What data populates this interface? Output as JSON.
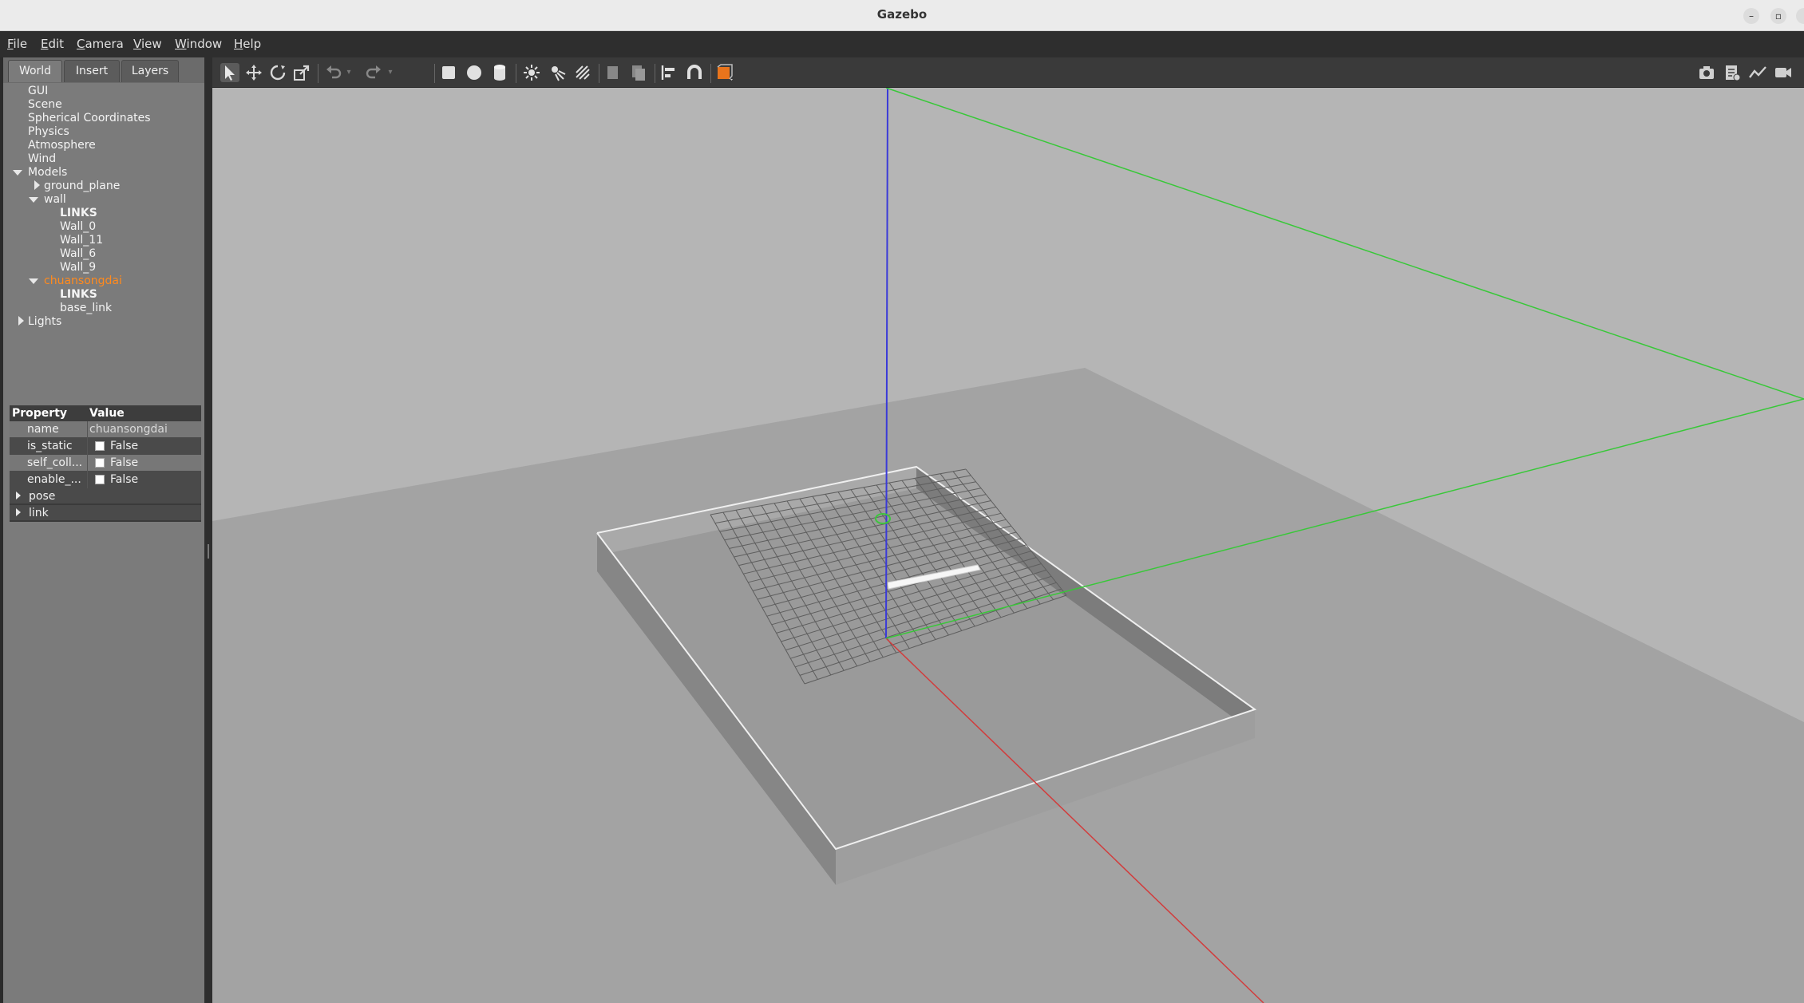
{
  "window": {
    "title": "Gazebo",
    "controls": [
      "minimize",
      "maximize",
      "close"
    ]
  },
  "menubar": {
    "items": [
      {
        "underline": "F",
        "rest": "ile"
      },
      {
        "underline": "E",
        "rest": "dit"
      },
      {
        "underline": "C",
        "rest": "amera"
      },
      {
        "underline": "V",
        "rest": "iew"
      },
      {
        "underline": "W",
        "rest": "indow"
      },
      {
        "underline": "H",
        "rest": "elp"
      }
    ]
  },
  "tabs": [
    "World",
    "Insert",
    "Layers"
  ],
  "active_tab": "World",
  "tree": {
    "gui": "GUI",
    "scene": "Scene",
    "spherical": "Spherical Coordinates",
    "physics": "Physics",
    "atmosphere": "Atmosphere",
    "wind": "Wind",
    "models": "Models",
    "ground_plane": "ground_plane",
    "wall": "wall",
    "wall_links": "LINKS",
    "wall_0": "Wall_0",
    "wall_11": "Wall_11",
    "wall_6": "Wall_6",
    "wall_9": "Wall_9",
    "selected_model": "chuansongdai",
    "sel_links": "LINKS",
    "base_link": "base_link",
    "lights": "Lights"
  },
  "properties": {
    "header_property": "Property",
    "header_value": "Value",
    "name_key": "name",
    "name_value": "chuansongdai",
    "is_static_key": "is_static",
    "is_static_value": "False",
    "self_coll_key": "self_coll...",
    "self_coll_value": "False",
    "enable_key": "enable_...",
    "enable_value": "False",
    "pose": "pose",
    "link": "link"
  },
  "toolbar": {
    "icons": [
      "select-mode-icon",
      "translate-mode-icon",
      "rotate-mode-icon",
      "scale-mode-icon",
      "undo-icon",
      "redo-icon",
      "box-icon",
      "sphere-icon",
      "cylinder-icon",
      "point-light-icon",
      "spot-light-icon",
      "directional-light-icon",
      "copy-icon",
      "paste-icon",
      "align-icon",
      "snap-icon",
      "view-angle-icon",
      "screenshot-icon",
      "log-icon",
      "plot-icon",
      "record-icon"
    ]
  },
  "colors": {
    "selected_model": "#ff8a1e",
    "axis_x": "#e04040",
    "axis_y": "#3ad13a",
    "axis_z": "#2020d0",
    "ground": "#a4a4a4",
    "sky": "#b4b4b4"
  }
}
